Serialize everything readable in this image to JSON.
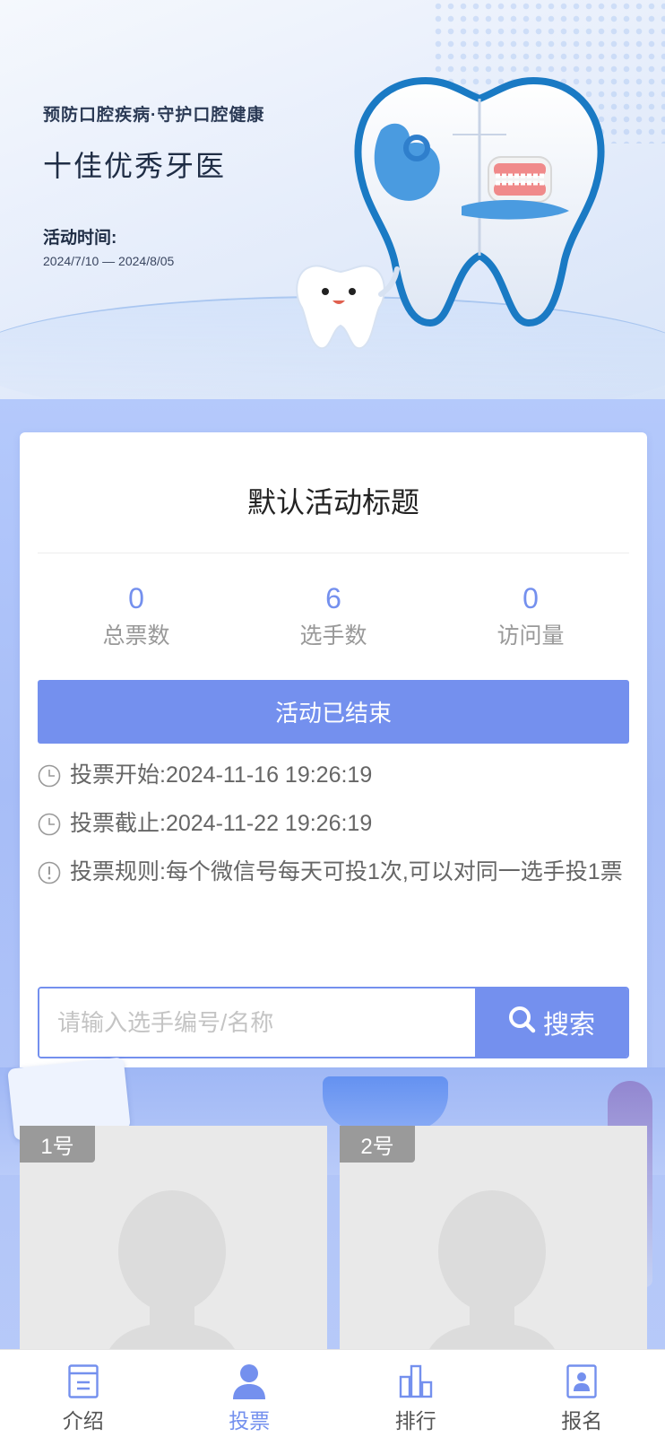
{
  "banner": {
    "subtitle": "预防口腔疾病·守护口腔健康",
    "title": "十佳优秀牙医",
    "time_label": "活动时间:",
    "time_range": "2024/7/10 — 2024/8/05"
  },
  "card": {
    "title": "默认活动标题",
    "stats": [
      {
        "value": "0",
        "label": "总票数"
      },
      {
        "value": "6",
        "label": "选手数"
      },
      {
        "value": "0",
        "label": "访问量"
      }
    ],
    "status_button": "活动已结束",
    "info": [
      {
        "icon": "clock-icon",
        "label": "投票开始:",
        "value": "2024-11-16 19:26:19"
      },
      {
        "icon": "clock-icon",
        "label": "投票截止:",
        "value": "2024-11-22 19:26:19"
      },
      {
        "icon": "info-icon",
        "label": "投票规则:",
        "value": "每个微信号每天可投1次,可以对同一选手投1票"
      }
    ],
    "search": {
      "placeholder": "请输入选手编号/名称",
      "value": "",
      "button": "搜索"
    }
  },
  "candidates": [
    {
      "number": "1号"
    },
    {
      "number": "2号"
    }
  ],
  "tabbar": {
    "items": [
      {
        "label": "介绍",
        "icon": "document-icon",
        "active": false
      },
      {
        "label": "投票",
        "icon": "user-icon",
        "active": true
      },
      {
        "label": "排行",
        "icon": "bar-chart-icon",
        "active": false
      },
      {
        "label": "报名",
        "icon": "contact-card-icon",
        "active": false
      }
    ]
  },
  "colors": {
    "accent": "#7490ee",
    "muted_text": "#999999",
    "body_text": "#666666",
    "candidate_placeholder_bg": "#e9e9e9"
  }
}
